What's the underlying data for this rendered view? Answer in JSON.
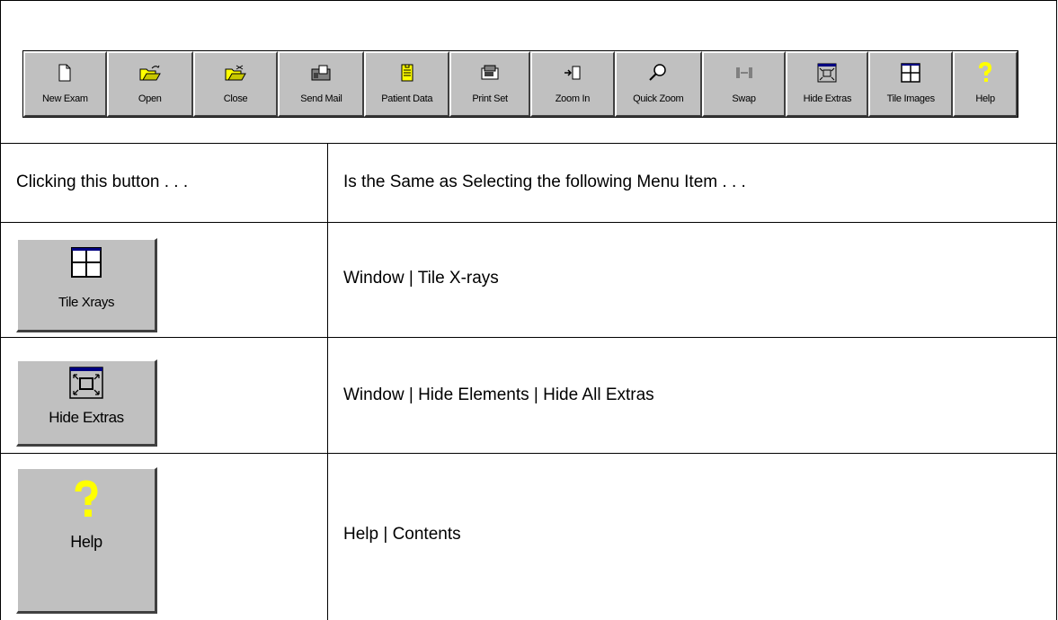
{
  "toolbar": {
    "buttons": [
      {
        "label": "New Exam",
        "icon": "new-document-icon"
      },
      {
        "label": "Open",
        "icon": "open-folder-icon"
      },
      {
        "label": "Close",
        "icon": "close-folder-icon"
      },
      {
        "label": "Send Mail",
        "icon": "send-mail-icon"
      },
      {
        "label": "Patient Data",
        "icon": "patient-data-icon"
      },
      {
        "label": "Print Set",
        "icon": "print-set-icon"
      },
      {
        "label": "Zoom In",
        "icon": "zoom-in-icon"
      },
      {
        "label": "Quick Zoom",
        "icon": "quick-zoom-icon"
      },
      {
        "label": "Swap",
        "icon": "swap-icon"
      },
      {
        "label": "Hide Extras",
        "icon": "hide-extras-icon"
      },
      {
        "label": "Tile Images",
        "icon": "tile-images-icon"
      },
      {
        "label": "Help",
        "icon": "help-icon"
      }
    ]
  },
  "table": {
    "header": {
      "col1": "Clicking this button . . .",
      "col2": "Is the Same as Selecting the following Menu Item . . ."
    },
    "rows": [
      {
        "button_label": "Tile Xrays",
        "icon": "tile-icon",
        "menu_item": "Window | Tile X-rays"
      },
      {
        "button_label": "Hide Extras",
        "icon": "hide-extras-icon",
        "menu_item": "Window | Hide Elements  | Hide All Extras"
      },
      {
        "button_label": "Help",
        "icon": "help-icon",
        "menu_item": "Help | Contents"
      }
    ]
  },
  "colors": {
    "button_face": "#c0c0c0",
    "help_yellow": "#ffff00",
    "accent_blue": "#000080"
  }
}
